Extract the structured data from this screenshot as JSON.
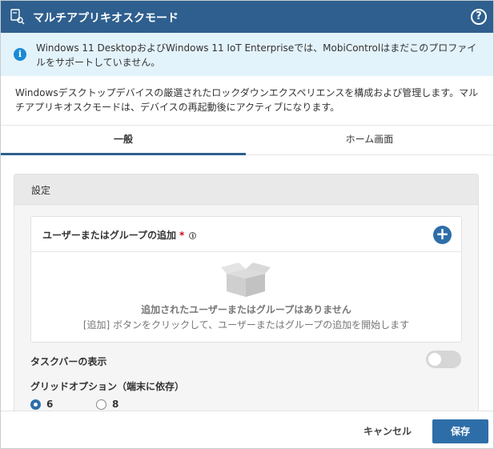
{
  "header": {
    "title": "マルチアプリキオスクモード",
    "icon": "settings-key-icon",
    "help_icon": "help-icon"
  },
  "info_banner": {
    "text": "Windows 11 DesktopおよびWindows 11 IoT Enterpriseでは、MobiControlはまだこのプロファイルをサポートしていません。"
  },
  "description": "Windowsデスクトップデバイスの厳選されたロックダウンエクスペリエンスを構成および管理します。マルチアプリキオスクモードは、デバイスの再起動後にアクティブになります。",
  "tabs": [
    {
      "label": "一般",
      "active": true
    },
    {
      "label": "ホーム画面",
      "active": false
    }
  ],
  "settings": {
    "title": "設定",
    "users_card": {
      "title": "ユーザーまたはグループの追加",
      "required_mark": "*",
      "info_glyph": "i",
      "add_glyph": "+",
      "empty_title": "追加されたユーザーまたはグループはありません",
      "empty_subtitle": "[追加] ボタンをクリックして、ユーザーまたはグループの追加を開始します"
    },
    "taskbar_label": "タスクバーの表示",
    "taskbar_enabled": false,
    "grid_label": "グリッドオプション（端末に依存）",
    "grid_options": [
      {
        "label": "6列",
        "selected": true
      },
      {
        "label": "8列",
        "selected": false
      }
    ]
  },
  "footer": {
    "cancel_label": "キャンセル",
    "save_label": "保存"
  },
  "colors": {
    "header_bg": "#2e5f8e",
    "accent": "#2e6ea8",
    "info_bg": "#e3f3fb",
    "info_icon": "#1a8ad4",
    "required": "#d0021b"
  }
}
